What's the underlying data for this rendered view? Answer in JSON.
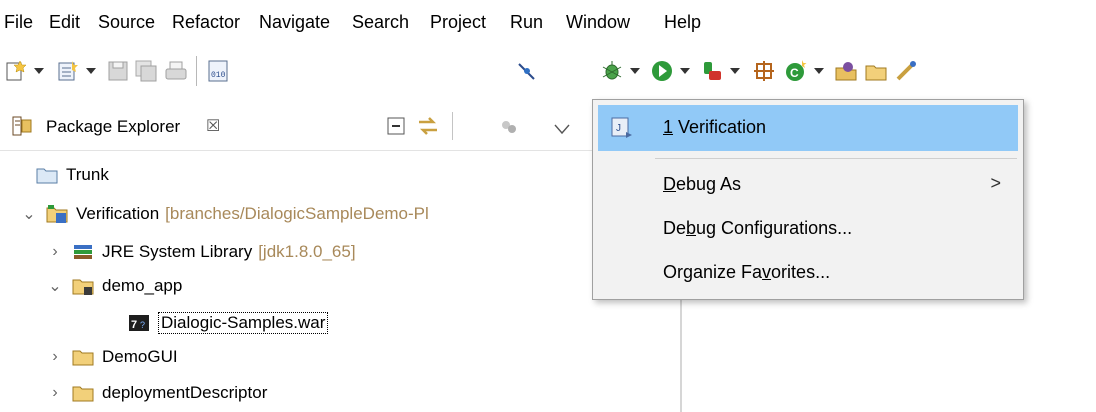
{
  "menubar": {
    "items": [
      "File",
      "Edit",
      "Source",
      "Refactor",
      "Navigate",
      "Search",
      "Project",
      "Run",
      "Window",
      "Help"
    ]
  },
  "toolbar": {
    "icons": [
      "new-wizard-icon",
      "new-icon",
      "save-icon",
      "save-all-icon",
      "print-icon",
      "binary-icon",
      "skip-breakpoints-icon",
      "debug-icon",
      "run-icon",
      "coverage-icon",
      "new-class-icon",
      "new-java-class-icon",
      "open-type-icon",
      "open-folder-icon",
      "brush-icon"
    ]
  },
  "package_explorer": {
    "title": "Package Explorer",
    "close_glyph": "☒"
  },
  "tree": [
    {
      "label": "Trunk",
      "decor": "",
      "expanded": null
    },
    {
      "label": "Verification",
      "decor": "[branches/DialogicSampleDemo-Pl",
      "expanded": true
    },
    {
      "label": "JRE System Library",
      "decor": "[jdk1.8.0_65]",
      "expanded": false
    },
    {
      "label": "demo_app",
      "decor": "",
      "expanded": true
    },
    {
      "label": "Dialogic-Samples.war",
      "decor": "",
      "expanded": null
    },
    {
      "label": "DemoGUI",
      "decor": "",
      "expanded": false
    },
    {
      "label": "deploymentDescriptor",
      "decor": "",
      "expanded": false
    }
  ],
  "debug_menu": {
    "recent": {
      "mnemonic": "1",
      "label": " Verification"
    },
    "debug_as": {
      "pre": "",
      "mn": "D",
      "post": "ebug As"
    },
    "debug_configs": {
      "pre": "De",
      "mn": "b",
      "post": "ug Configurations..."
    },
    "organize": {
      "pre": "Organize Fa",
      "mn": "v",
      "post": "orites..."
    },
    "submenu_arrow": ">"
  },
  "colors": {
    "highlight": "#91c9f7",
    "menu_bg": "#f2f2f2",
    "decorator": "#a8895a"
  }
}
